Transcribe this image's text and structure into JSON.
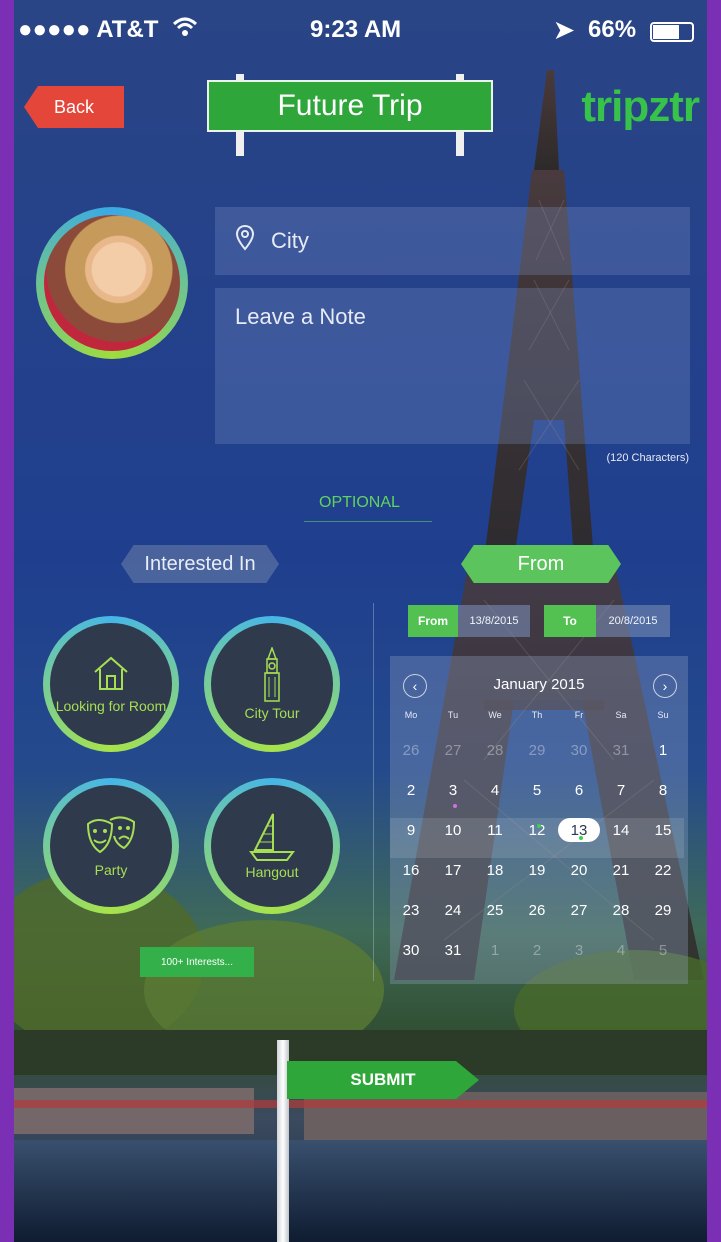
{
  "status_bar": {
    "carrier": "●●●●● AT&T",
    "time": "9:23 AM",
    "battery": "66%"
  },
  "header": {
    "back_label": "Back",
    "title": "Future Trip",
    "logo": "tripztr"
  },
  "form": {
    "city_placeholder": "City",
    "note_placeholder": "Leave a Note",
    "char_limit": "(120 Characters)"
  },
  "optional_label": "OPTIONAL",
  "interested_label": "Interested In",
  "from_tag_label": "From",
  "interests": [
    {
      "label": "Looking for Room",
      "icon": "house-icon"
    },
    {
      "label": "City Tour",
      "icon": "big-ben-icon"
    },
    {
      "label": "Party",
      "icon": "theater-masks-icon"
    },
    {
      "label": "Hangout",
      "icon": "sailboat-icon"
    }
  ],
  "more_interests_label": "100+ Interests...",
  "date_range": {
    "from_label": "From",
    "from_value": "13/8/2015",
    "to_label": "To",
    "to_value": "20/8/2015"
  },
  "calendar": {
    "month_title": "January 2015",
    "weekdays": [
      "Mo",
      "Tu",
      "We",
      "Th",
      "Fr",
      "Sa",
      "Su"
    ],
    "weeks": [
      [
        "26",
        "27",
        "28",
        "29",
        "30",
        "31",
        "1"
      ],
      [
        "2",
        "3",
        "4",
        "5",
        "6",
        "7",
        "8"
      ],
      [
        "9",
        "10",
        "11",
        "12",
        "13",
        "14",
        "15"
      ],
      [
        "16",
        "17",
        "18",
        "19",
        "20",
        "21",
        "22"
      ],
      [
        "23",
        "24",
        "25",
        "26",
        "27",
        "28",
        "29"
      ],
      [
        "30",
        "31",
        "1",
        "2",
        "3",
        "4",
        "5"
      ]
    ],
    "selected_day": "13"
  },
  "submit_label": "SUBMIT",
  "colors": {
    "accent_green": "#2ea63a",
    "back_red": "#e4463a",
    "ring_blue": "#46b6e8",
    "ring_green": "#a8e34a"
  }
}
